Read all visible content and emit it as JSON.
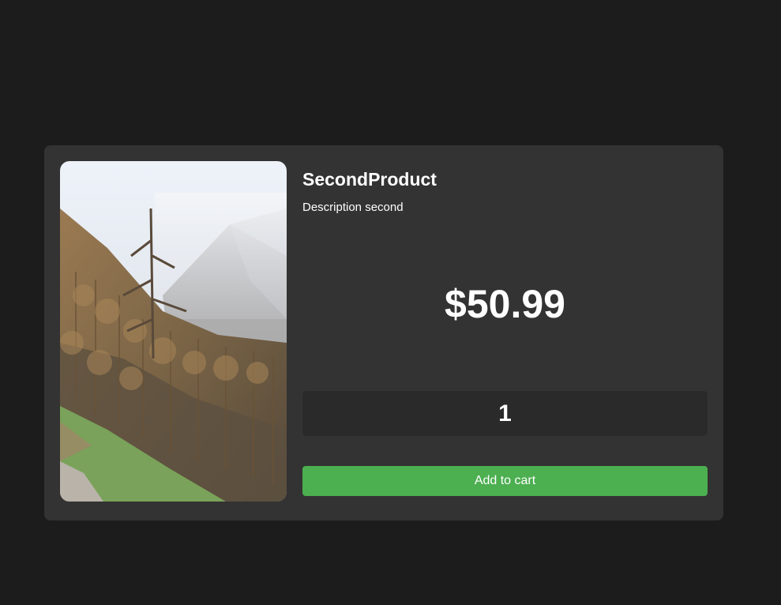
{
  "product": {
    "name": "SecondProduct",
    "description": "Description second",
    "price": "$50.99",
    "quantity": "1",
    "add_to_cart_label": "Add to cart",
    "image_subject": "misty-mountain-forest"
  },
  "colors": {
    "background": "#1c1c1c",
    "card": "#333333",
    "quantity_field": "#2a2a2a",
    "button": "#4caf50",
    "text": "#ffffff"
  }
}
